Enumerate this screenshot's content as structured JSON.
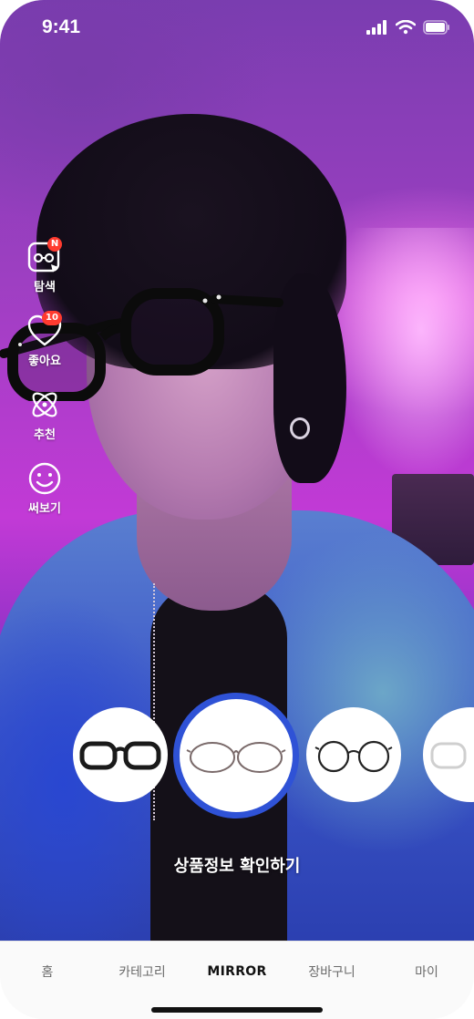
{
  "status_bar": {
    "time": "9:41"
  },
  "side_menu": {
    "items": [
      {
        "label": "탐색",
        "icon": "explore-glasses-icon",
        "badge": "N"
      },
      {
        "label": "좋아요",
        "icon": "heart-icon",
        "badge": "10"
      },
      {
        "label": "추천",
        "icon": "atom-icon"
      },
      {
        "label": "써보기",
        "icon": "smiley-face-icon"
      }
    ]
  },
  "carousel": {
    "items": [
      {
        "name": "black-thick-frame-glasses",
        "selected": false
      },
      {
        "name": "thin-metal-round-glasses",
        "selected": true
      },
      {
        "name": "black-round-metal-glasses",
        "selected": false
      },
      {
        "name": "clear-frame-glasses",
        "selected": false
      }
    ],
    "selected_index": 1
  },
  "cta_label": "상품정보 확인하기",
  "tab_bar": {
    "tabs": [
      {
        "label": "홈"
      },
      {
        "label": "카테고리"
      },
      {
        "label": "MIRROR",
        "active": true
      },
      {
        "label": "장바구니"
      },
      {
        "label": "마이"
      }
    ]
  },
  "colors": {
    "accent": "#2f52d6",
    "badge": "#ff3b2f",
    "tab_active": "#111111",
    "tab_inactive": "#6b6b6b"
  }
}
